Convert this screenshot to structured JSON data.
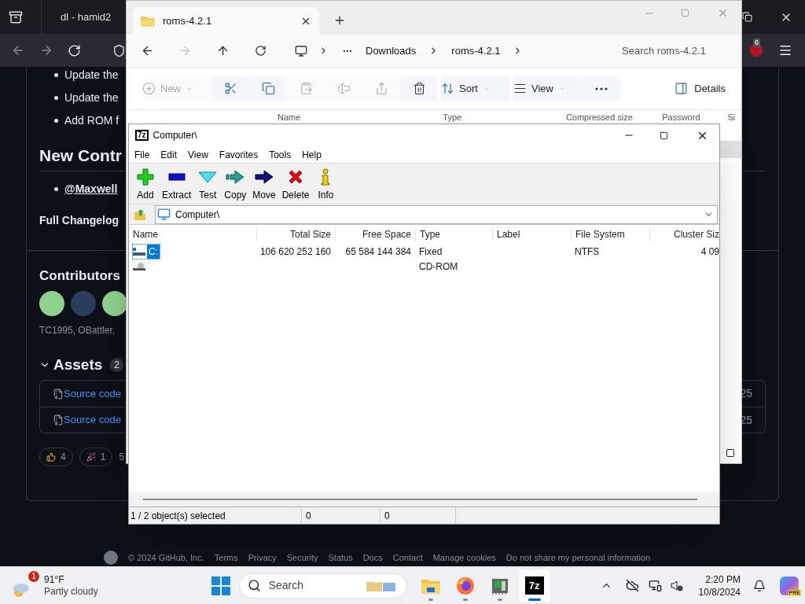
{
  "browser": {
    "tab_title": "dl - hamid2",
    "extension_badge": "6"
  },
  "page": {
    "bullets": [
      "Update the",
      "Update the",
      "Add ROM f"
    ],
    "new_contributors_heading": "New Contr",
    "new_contributor": "@Maxwell",
    "changelog": "Full Changelog",
    "contributors_heading": "Contributors",
    "contributor_names": "TC1995, OBattler,",
    "assets_heading": "Assets",
    "assets_count": "2",
    "assets": [
      {
        "label": "Source code",
        "date": "25"
      },
      {
        "label": "Source code",
        "date": "25"
      }
    ],
    "reactions": [
      {
        "kind": "thumbs",
        "count": "4"
      },
      {
        "kind": "party",
        "count": "1"
      }
    ],
    "reaction_summary": "5",
    "footer": {
      "copyright": "© 2024 GitHub, Inc.",
      "links": [
        "Terms",
        "Privacy",
        "Security",
        "Status",
        "Docs",
        "Contact",
        "Manage cookies",
        "Do not share my personal information"
      ]
    }
  },
  "explorer": {
    "tab_title": "roms-4.2.1",
    "breadcrumb": [
      "Downloads",
      "roms-4.2.1"
    ],
    "search": {
      "placeholder": "Search roms-4.2.1"
    },
    "toolbar": [
      {
        "kind": "new",
        "label": "New",
        "disabled": true
      },
      {
        "kind": "cut",
        "disabled": false
      },
      {
        "kind": "copy",
        "disabled": false
      },
      {
        "kind": "paste",
        "disabled": true
      },
      {
        "kind": "rename",
        "disabled": true
      },
      {
        "kind": "share",
        "disabled": true
      },
      {
        "kind": "delete",
        "disabled": false
      },
      {
        "kind": "sort",
        "label": "Sort",
        "disabled": false
      },
      {
        "kind": "view",
        "label": "View",
        "disabled": false
      },
      {
        "kind": "more",
        "disabled": false
      }
    ],
    "details_label": "Details",
    "columns": [
      "Name",
      "Type",
      "Compressed size",
      "Password",
      "Si"
    ]
  },
  "sevenzip": {
    "icon_label": "7z",
    "title": "Computer\\",
    "menu": [
      "File",
      "Edit",
      "View",
      "Favorites",
      "Tools",
      "Help"
    ],
    "toolbar": [
      {
        "kind": "add",
        "label": "Add"
      },
      {
        "kind": "extract",
        "label": "Extract"
      },
      {
        "kind": "test",
        "label": "Test"
      },
      {
        "kind": "copy",
        "label": "Copy"
      },
      {
        "kind": "move",
        "label": "Move"
      },
      {
        "kind": "delete",
        "label": "Delete"
      },
      {
        "kind": "info",
        "label": "Info"
      }
    ],
    "address": "Computer\\",
    "columns": [
      "Name",
      "Total Size",
      "Free Space",
      "Type",
      "Label",
      "File System",
      "Cluster Siz"
    ],
    "rows": [
      {
        "kind": "disk",
        "name": "C:",
        "total_size": "106 620 252 160",
        "free_space": "65 584 144 384",
        "type": "Fixed",
        "file_system": "NTFS",
        "cluster_size": "4 09",
        "selected": true
      },
      {
        "kind": "cdrom",
        "type": "CD-ROM",
        "selected": false
      }
    ],
    "status": [
      "1 / 2 object(s) selected",
      "0",
      "0"
    ]
  },
  "taskbar": {
    "weather": {
      "temperature": "91°F",
      "condition": "Partly cloudy",
      "badge": "1"
    },
    "search": {
      "placeholder": "Search"
    },
    "apps": [
      {
        "kind": "folder",
        "selected": false
      },
      {
        "kind": "firefox",
        "selected": false
      },
      {
        "kind": "chip",
        "selected": false
      },
      {
        "kind": "sevenzip",
        "label": "7z",
        "selected": true
      }
    ],
    "time": "2:20 PM",
    "date": "10/8/2024",
    "copilot_badge": "PRE"
  }
}
